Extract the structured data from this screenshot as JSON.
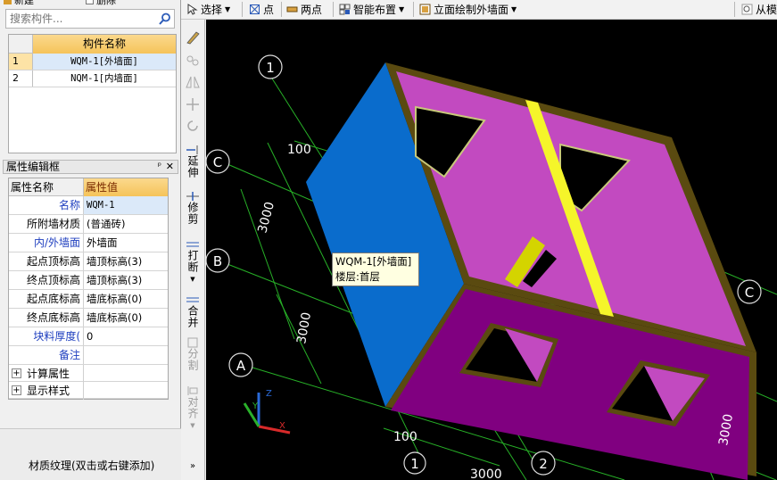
{
  "toolbar": {
    "new_label": "新建",
    "delete_label": "删除",
    "select_label": "选择",
    "point_label": "点",
    "two_point_label": "两点",
    "smart_layout_label": "智能布置",
    "elevation_draw_label": "立面绘制外墙面",
    "from_label": "从模"
  },
  "search": {
    "placeholder": "搜索构件..."
  },
  "component_table": {
    "header": "构件名称",
    "rows": [
      {
        "num": "1",
        "name": "WQM-1[外墙面]",
        "selected": true
      },
      {
        "num": "2",
        "name": "NQM-1[内墙面]",
        "selected": false
      }
    ]
  },
  "property_panel": {
    "title": "属性编辑框",
    "pin": "ᵖ",
    "close": "✕",
    "col_name": "属性名称",
    "col_value": "属性值",
    "rows": [
      {
        "name": "名称",
        "value": "WQM-1",
        "blue": true
      },
      {
        "name": "所附墙材质",
        "value": "(普通砖)",
        "blue": false
      },
      {
        "name": "内/外墙面",
        "value": "外墙面",
        "blue": true
      },
      {
        "name": "起点顶标高",
        "value": "墙顶标高(3)",
        "blue": false
      },
      {
        "name": "终点顶标高",
        "value": "墙顶标高(3)",
        "blue": false
      },
      {
        "name": "起点底标高",
        "value": "墙底标高(0)",
        "blue": false
      },
      {
        "name": "终点底标高",
        "value": "墙底标高(0)",
        "blue": false
      },
      {
        "name": "块料厚度(",
        "value": "0",
        "blue": true
      },
      {
        "name": "备注",
        "value": "",
        "blue": true
      }
    ],
    "groups": [
      "计算属性",
      "显示样式"
    ],
    "texture_label": "材质纹理(双击或右键添加)"
  },
  "side_tools": [
    "延伸",
    "修剪",
    "打断",
    "合并",
    "分割",
    "对齐"
  ],
  "tooltip": {
    "line1": "WQM-1[外墙面]",
    "line2": "楼层:首层"
  },
  "canvas": {
    "axis_labels": [
      "1",
      "C",
      "B",
      "A",
      "2",
      "C",
      "1"
    ],
    "dimension_labels": [
      "100",
      "3000",
      "3000",
      "3000",
      "100",
      "3000",
      "3000"
    ]
  },
  "colors": {
    "wall_top": "#c24ac0",
    "wall_front": "#800080",
    "wall_left": "#0a6ccc",
    "grid": "#27b027",
    "highlight_column": "#f5f52a",
    "wall_edge": "#6a5a16"
  }
}
